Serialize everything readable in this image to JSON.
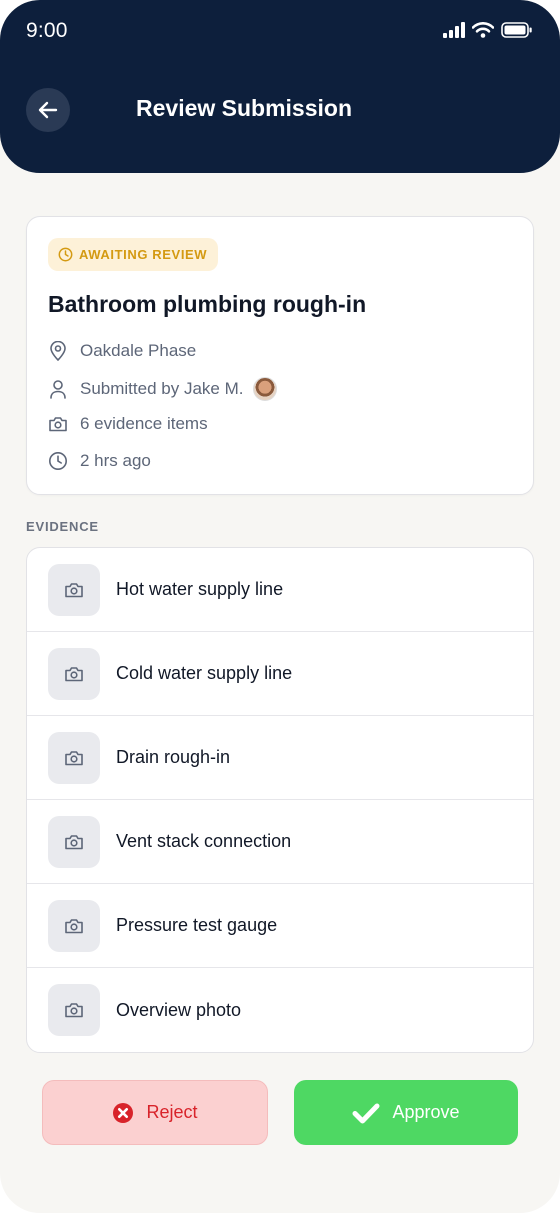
{
  "status_bar": {
    "time": "9:00"
  },
  "header": {
    "title": "Review Submission"
  },
  "submission": {
    "badge": "AWAITING REVIEW",
    "title": "Bathroom plumbing rough-in",
    "location": "Oakdale Phase",
    "submitted_by": "Submitted by Jake M.",
    "evidence_count": "6 evidence items",
    "time_ago": "2 hrs ago"
  },
  "evidence": {
    "section_label": "EVIDENCE",
    "items": [
      {
        "label": "Hot water supply line"
      },
      {
        "label": "Cold water supply line"
      },
      {
        "label": "Drain rough-in"
      },
      {
        "label": "Vent stack connection"
      },
      {
        "label": "Pressure test gauge"
      },
      {
        "label": "Overview photo"
      }
    ]
  },
  "actions": {
    "reject_label": "Reject",
    "approve_label": "Approve"
  },
  "colors": {
    "header_bg": "#0d1f3c",
    "badge_bg": "#fdf1d8",
    "badge_text": "#d49a12",
    "reject_bg": "#fbd0d0",
    "reject_text": "#d8232a",
    "approve_bg": "#4ed863"
  }
}
